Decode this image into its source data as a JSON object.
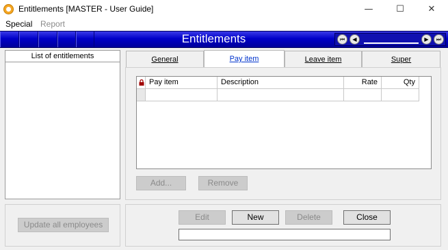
{
  "window": {
    "title": "Entitlements [MASTER - User Guide]",
    "controls": {
      "minimize": "—",
      "maximize": "☐",
      "close": "✕"
    }
  },
  "menu": {
    "items": [
      "Special",
      "Report"
    ]
  },
  "header": {
    "title": "Entitlements",
    "nav": {
      "first": "⏮",
      "prev": "◀",
      "next": "▶",
      "last": "⏭"
    }
  },
  "left_panel": {
    "header": "List of entitlements",
    "update_button": "Update all employees"
  },
  "tabs": [
    {
      "label": "General",
      "active": false
    },
    {
      "label": "Pay item",
      "active": true
    },
    {
      "label": "Leave item",
      "active": false
    },
    {
      "label": "Super",
      "active": false
    }
  ],
  "grid": {
    "columns": [
      "Pay item",
      "Description",
      "Rate",
      "Qty"
    ],
    "rows": []
  },
  "grid_buttons": {
    "add": "Add...",
    "remove": "Remove"
  },
  "footer_buttons": {
    "edit": "Edit",
    "new": "New",
    "delete": "Delete",
    "close": "Close"
  },
  "colors": {
    "header_blue": "#0000c8",
    "active_tab_text": "#0033cc",
    "lock": "#a00000"
  }
}
